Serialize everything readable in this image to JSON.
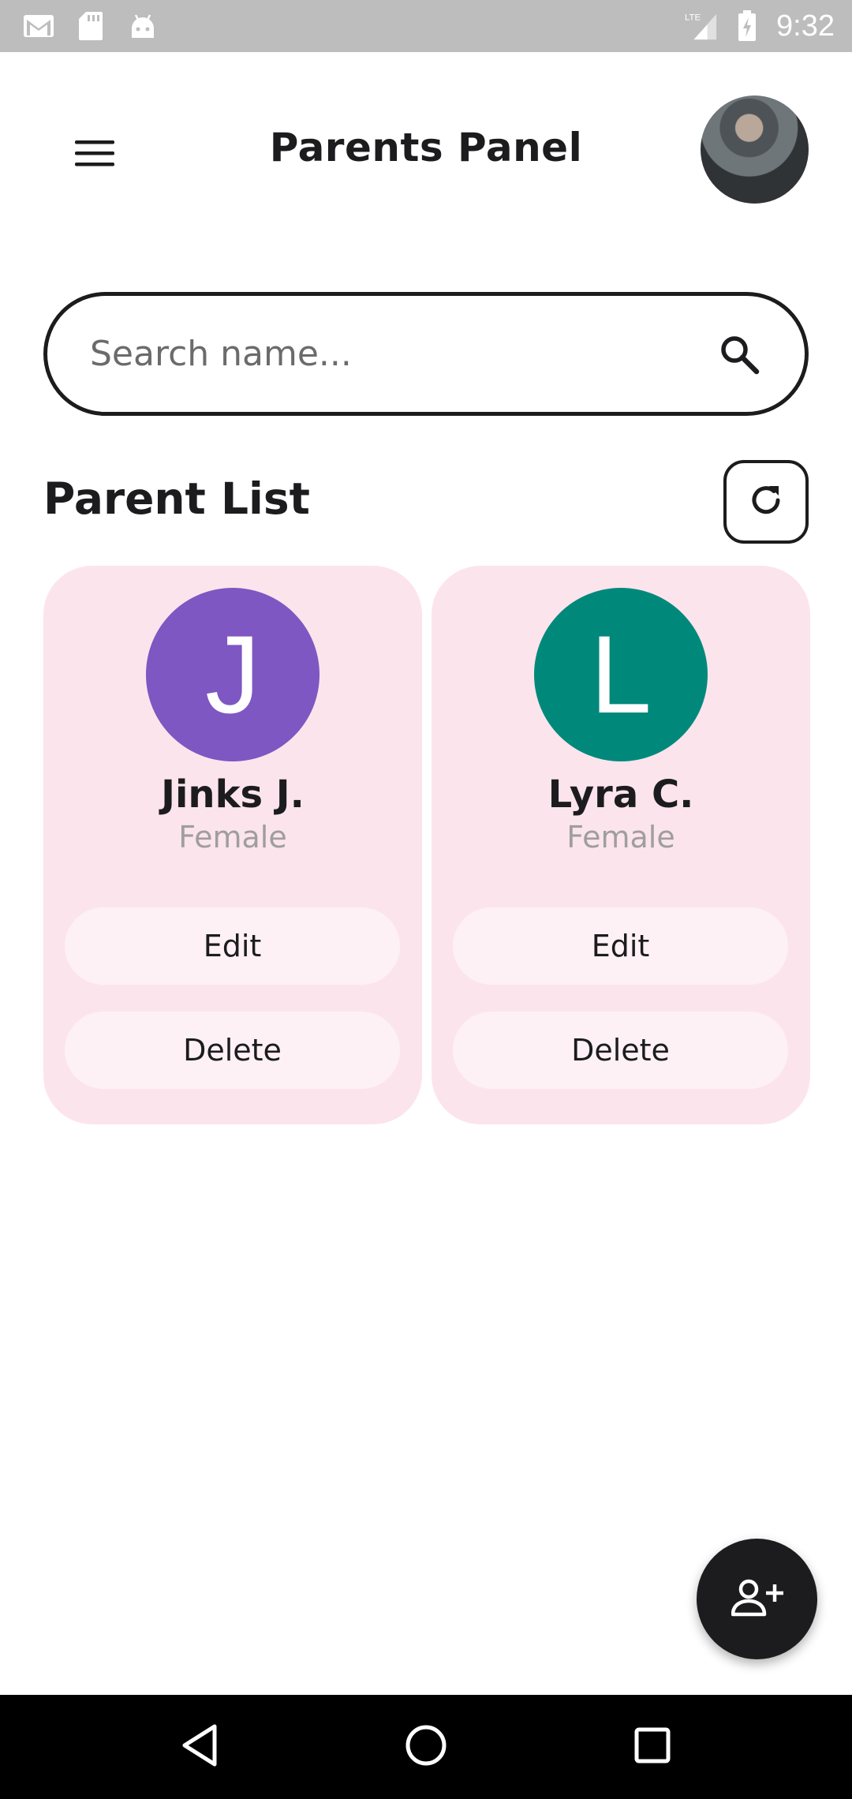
{
  "status_bar": {
    "time": "9:32",
    "network": "LTE",
    "icons": [
      "gmail-icon",
      "sd-card-icon",
      "android-icon",
      "signal-icon",
      "battery-charging-icon"
    ]
  },
  "header": {
    "title": "Parents Panel",
    "menu_icon": "menu-icon",
    "avatar": "user-avatar"
  },
  "search": {
    "placeholder": "Search name...",
    "value": "",
    "icon": "search-icon"
  },
  "section": {
    "title": "Parent List",
    "refresh_icon": "refresh-icon"
  },
  "parents": [
    {
      "initial": "J",
      "name": "Jinks J.",
      "gender": "Female",
      "color": "#7e57c2",
      "edit_label": "Edit",
      "delete_label": "Delete"
    },
    {
      "initial": "L",
      "name": "Lyra C.",
      "gender": "Female",
      "color": "#00897b",
      "edit_label": "Edit",
      "delete_label": "Delete"
    }
  ],
  "fab": {
    "icon": "add-person-icon"
  },
  "nav_bar": {
    "icons": [
      "back-icon",
      "home-icon",
      "recents-icon"
    ]
  },
  "colors": {
    "card_bg": "#fce4ec",
    "card_button_bg": "#fdf1f5",
    "dark": "#1c1c1e",
    "status_bar": "#bdbdbd"
  }
}
